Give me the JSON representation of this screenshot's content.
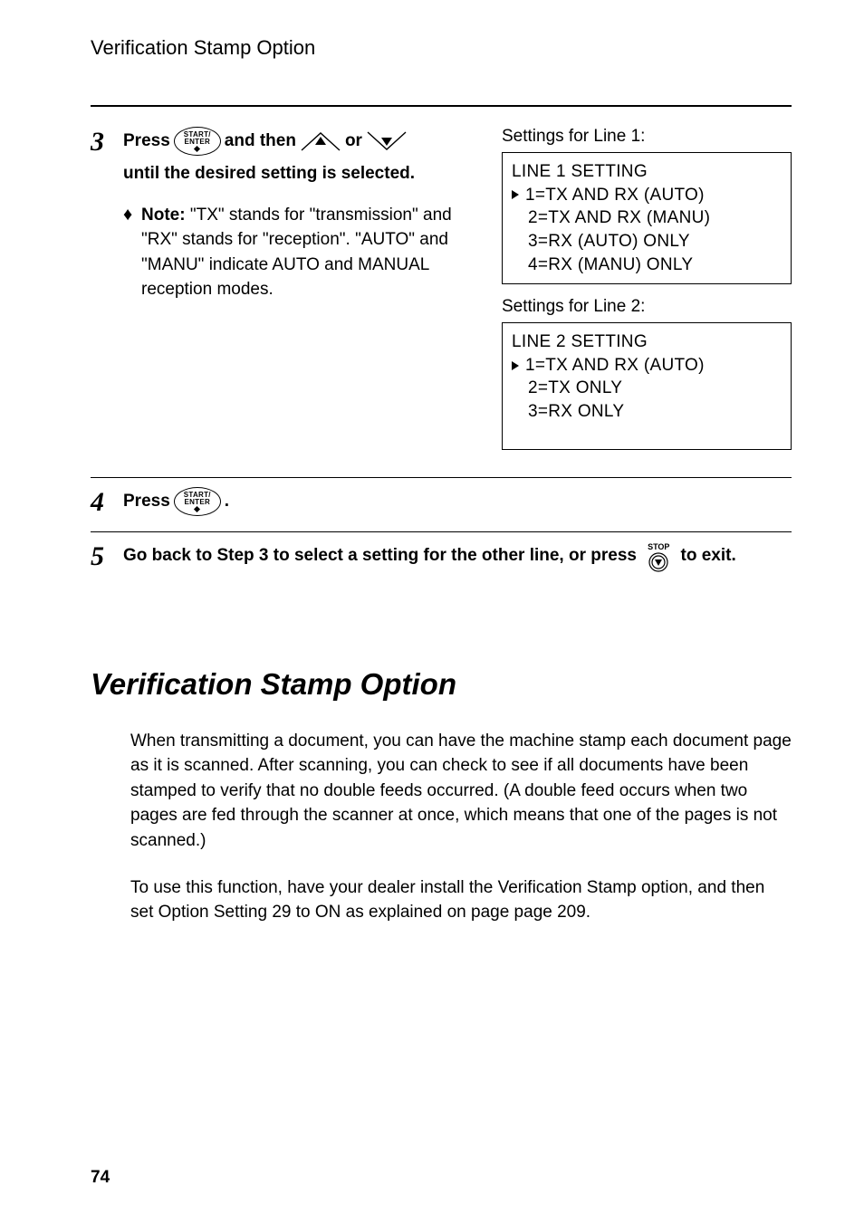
{
  "running_header": "Verification Stamp Option",
  "step3": {
    "press": "Press",
    "and_then": " and then ",
    "or": " or ",
    "until": "until the desired setting is selected.",
    "note_label": "Note:",
    "note_text": " \"TX\" stands for \"transmission\" and \"RX\" stands for \"reception\". \"AUTO\" and \"MANU\" indicate AUTO and MANUAL reception modes."
  },
  "right": {
    "caption1": "Settings for Line 1:",
    "box1": {
      "title": "LINE 1 SETTING",
      "opt1": "1=TX AND RX (AUTO)",
      "opt2": "2=TX AND RX (MANU)",
      "opt3": "3=RX (AUTO) ONLY",
      "opt4": "4=RX (MANU) ONLY"
    },
    "caption2": "Settings for Line 2:",
    "box2": {
      "title": "LINE 2 SETTING",
      "opt1": "1=TX AND RX (AUTO)",
      "opt2": "2=TX ONLY",
      "opt3": "3=RX ONLY"
    }
  },
  "step4": {
    "press": "Press ",
    "period": "."
  },
  "step5": {
    "text_before": "Go back to Step 3 to select a setting for the other line, or press ",
    "text_after": " to exit."
  },
  "section_title": "Verification Stamp Option",
  "para1": "When transmitting a document, you can have the machine stamp each document page as it is scanned. After scanning, you can check to see if all documents have been stamped to verify that no double feeds occurred. (A double feed occurs when two pages are fed through the scanner at once, which means that one of the pages is not scanned.)",
  "para2": "To use this function, have your dealer install the Verification Stamp option, and then set Option Setting 29 to ON as explained on page page 209.",
  "page_number": "74",
  "icons": {
    "start_enter_l1": "START/",
    "start_enter_l2": "ENTER",
    "stop_label": "STOP"
  }
}
